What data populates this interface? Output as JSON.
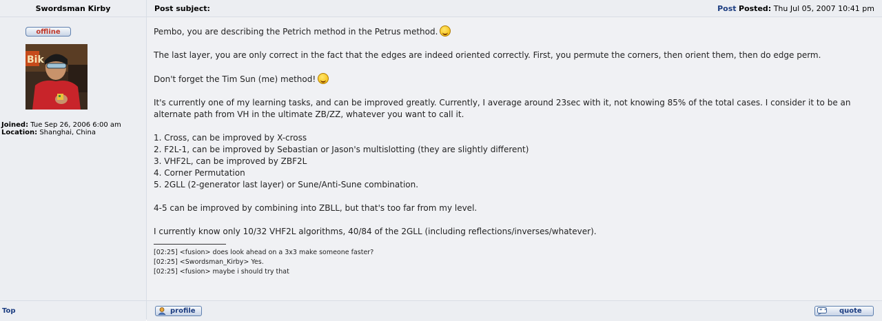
{
  "author": {
    "name": "Swordsman Kirby",
    "status": "offline",
    "joined_label": "Joined:",
    "joined_value": "Tue Sep 26, 2006 6:00 am",
    "location_label": "Location:",
    "location_value": "Shanghai, China"
  },
  "header": {
    "subject_label": "Post subject:",
    "post_link": "Post",
    "posted_label": "Posted:",
    "posted_value": "Thu Jul 05, 2007 10:41 pm"
  },
  "message": {
    "p1": "Pembo, you are describing the Petrich method in the Petrus method.",
    "p2": "The last layer, you are only correct in the fact that the edges are indeed oriented correctly. First, you permute the corners, then orient them, then do edge perm.",
    "p3": "Don't forget the Tim Sun (me) method!",
    "p4": "It's currently one of my learning tasks, and can be improved greatly. Currently, I average around 23sec with it, not knowing 85% of the total cases. I consider it to be an alternate path from VH in the ultimate ZB/ZZ, whatever you want to call it.",
    "list": [
      "1. Cross, can be improved by X-cross",
      "2. F2L-1, can be improved by Sebastian or Jason's multislotting (they are slightly different)",
      "3. VHF2L, can be improved by ZBF2L",
      "4. Corner Permutation",
      "5. 2GLL (2-generator last layer) or Sune/Anti-Sune combination."
    ],
    "p5": "4-5 can be improved by combining into ZBLL, but that's too far from my level.",
    "p6": "I currently know only 10/32 VHF2L algorithms, 40/84 of the 2GLL (including reflections/inverses/whatever).",
    "smileys": [
      "razz-smiley-icon",
      "grin-smiley-icon"
    ]
  },
  "signature": [
    "[02:25] <fusion> does look ahead on a 3x3 make someone faster?",
    "[02:25] <Swordsman_Kirby> Yes.",
    "[02:25] <fusion> maybe i should try that"
  ],
  "footer": {
    "top_link": "Top",
    "profile_button": "profile",
    "quote_button": "quote"
  },
  "colors": {
    "link": "#1b3c80",
    "offline": "#c0392b",
    "row_bg": "#eceef2",
    "border": "#d8dde5"
  }
}
